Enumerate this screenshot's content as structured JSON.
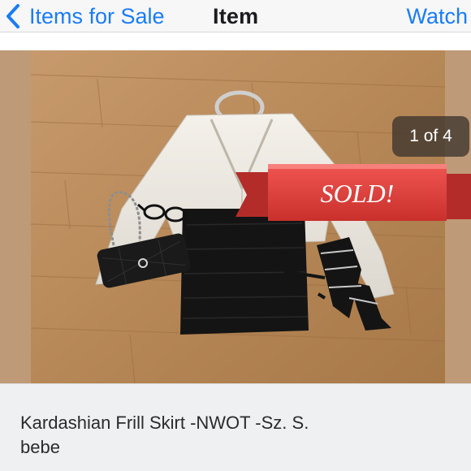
{
  "navbar": {
    "back_label": "Items for Sale",
    "title": "Item",
    "action_label": "Watch",
    "accent_color": "#1a7cf5"
  },
  "photo": {
    "pager": "1 of 4",
    "banner_text": "SOLD!",
    "banner_color": "#e2433f"
  },
  "listing": {
    "title_line1": "Kardashian Frill Skirt -NWOT -Sz. S.",
    "title_line2": "bebe"
  },
  "icons": {
    "back": "chevron-left-icon"
  }
}
